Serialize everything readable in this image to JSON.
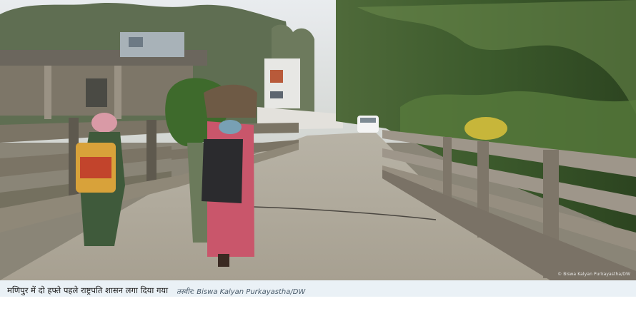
{
  "photo": {
    "watermark": "© Biswa Kalyan Purkayastha/DW"
  },
  "caption": {
    "text": "मणिपुर में दो हफ्ते पहले राष्ट्रपति शासन लगा दिया गया",
    "credit_label": "तस्वीर:",
    "credit_name": "Biswa Kalyan Purkayastha/DW"
  }
}
